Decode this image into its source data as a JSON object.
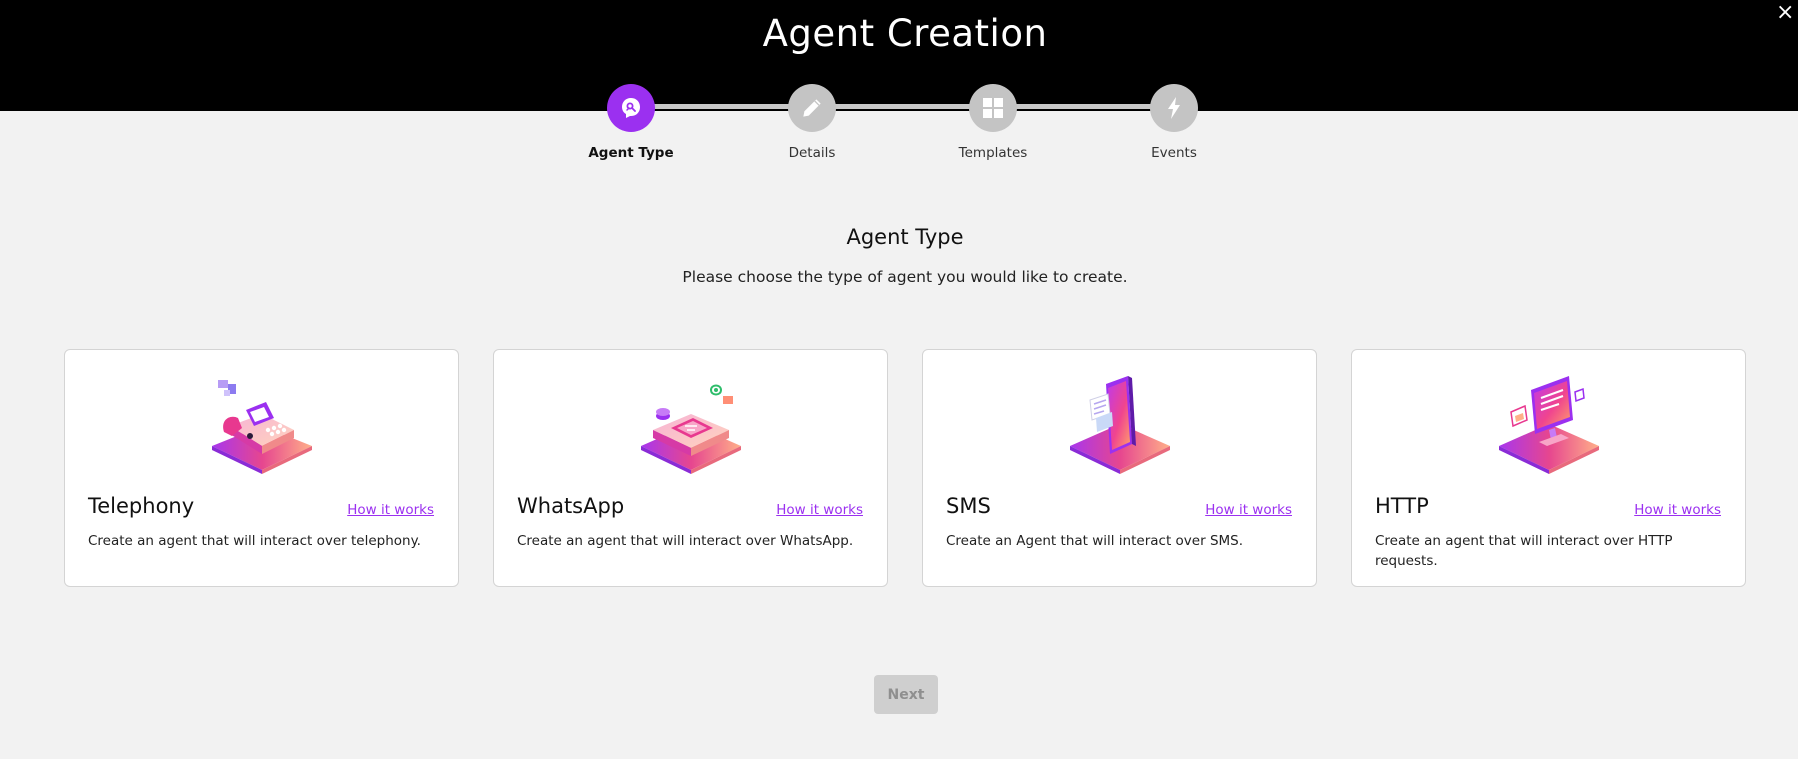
{
  "header": {
    "title": "Agent Creation",
    "close_label": "×"
  },
  "stepper": {
    "steps": [
      {
        "label": "Agent Type",
        "icon": "agent-type-icon",
        "active": true
      },
      {
        "label": "Details",
        "icon": "pencil-icon",
        "active": false
      },
      {
        "label": "Templates",
        "icon": "grid-icon",
        "active": false
      },
      {
        "label": "Events",
        "icon": "lightning-icon",
        "active": false
      }
    ]
  },
  "main": {
    "title": "Agent Type",
    "subtitle": "Please choose the type of agent you would like to create."
  },
  "cards": [
    {
      "title": "Telephony",
      "link": "How it works",
      "description": "Create an agent that will interact over telephony.",
      "icon": "telephone-illustration"
    },
    {
      "title": "WhatsApp",
      "link": "How it works",
      "description": "Create an agent that will interact over WhatsApp.",
      "icon": "whatsapp-illustration"
    },
    {
      "title": "SMS",
      "link": "How it works",
      "description": "Create an Agent that will interact over SMS.",
      "icon": "sms-illustration"
    },
    {
      "title": "HTTP",
      "link": "How it works",
      "description": "Create an agent that will interact over HTTP requests.",
      "icon": "http-illustration"
    }
  ],
  "footer": {
    "next_label": "Next"
  },
  "colors": {
    "accent": "#9b30f0",
    "header_bg": "#000000",
    "page_bg": "#f2f2f2",
    "inactive_step": "#c4c4c4"
  }
}
